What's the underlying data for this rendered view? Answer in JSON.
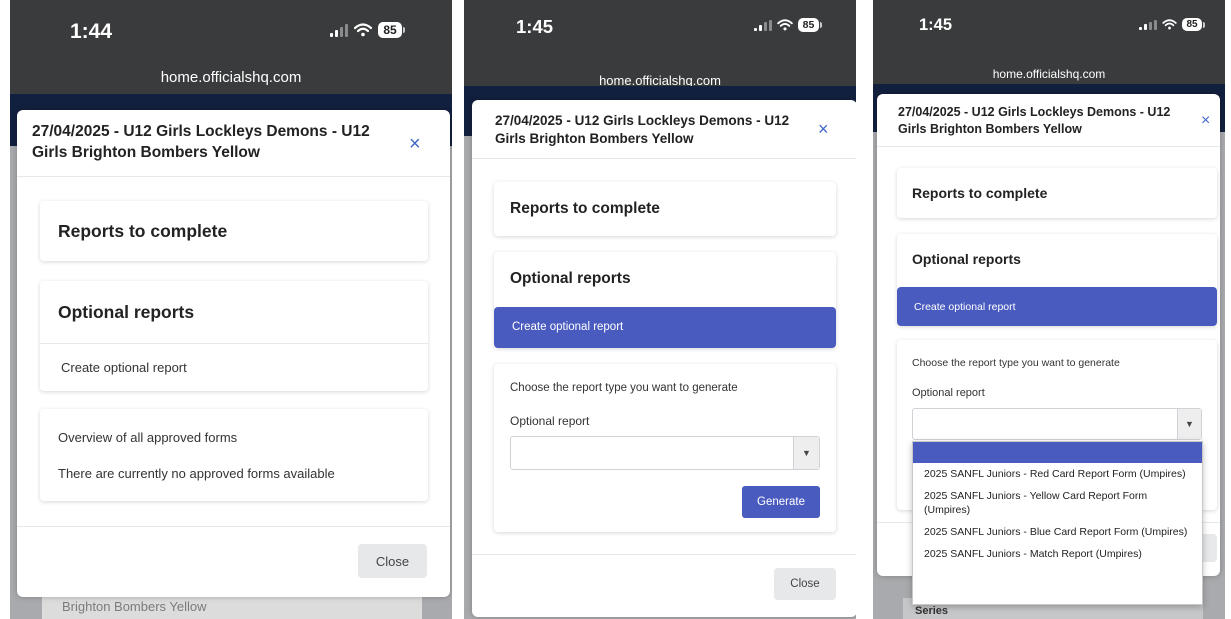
{
  "screens": [
    {
      "time": "1:44",
      "battery": "85",
      "url": "home.officialshq.com",
      "modal_title": "27/04/2025 - U12 Girls Lockleys Demons - U12 Girls Brighton Bombers Yellow",
      "close_x": "×",
      "reports_to_complete": "Reports to complete",
      "optional_reports": "Optional reports",
      "create_optional_report": "Create optional report",
      "overview_heading": "Overview of all approved forms",
      "no_forms": "There are currently no approved forms available",
      "close_button": "Close",
      "background_text": "Brighton Bombers Yellow"
    },
    {
      "time": "1:45",
      "battery": "85",
      "url": "home.officialshq.com",
      "modal_title": "27/04/2025 - U12 Girls Lockleys Demons - U12 Girls Brighton Bombers Yellow",
      "close_x": "×",
      "reports_to_complete": "Reports to complete",
      "optional_reports": "Optional reports",
      "create_optional_report": "Create optional report",
      "choose_type": "Choose the report type you want to generate",
      "optional_report_label": "Optional report",
      "select_value": "",
      "select_arrow": "▼",
      "generate_button": "Generate",
      "close_button": "Close"
    },
    {
      "time": "1:45",
      "battery": "85",
      "url": "home.officialshq.com",
      "modal_title": "27/04/2025 - U12 Girls Lockleys Demons - U12 Girls Brighton Bombers Yellow",
      "close_x": "×",
      "reports_to_complete": "Reports to complete",
      "optional_reports": "Optional reports",
      "create_optional_report": "Create optional report",
      "choose_type": "Choose the report type you want to generate",
      "optional_report_label": "Optional report",
      "select_arrow": "▼",
      "dropdown_options": [
        "2025 SANFL Juniors - Red Card Report Form (Umpires)",
        "2025 SANFL Juniors - Yellow Card Report Form (Umpires)",
        "2025 SANFL Juniors - Blue Card Report Form (Umpires)",
        "2025 SANFL Juniors - Match Report (Umpires)"
      ],
      "background_text": "Series"
    }
  ],
  "colors": {
    "accent": "#4a5bbf",
    "close_x": "#4169c9",
    "status_bar": "#3a3b3c",
    "header_navy": "#12203f",
    "overlay": "#a9aaad"
  }
}
